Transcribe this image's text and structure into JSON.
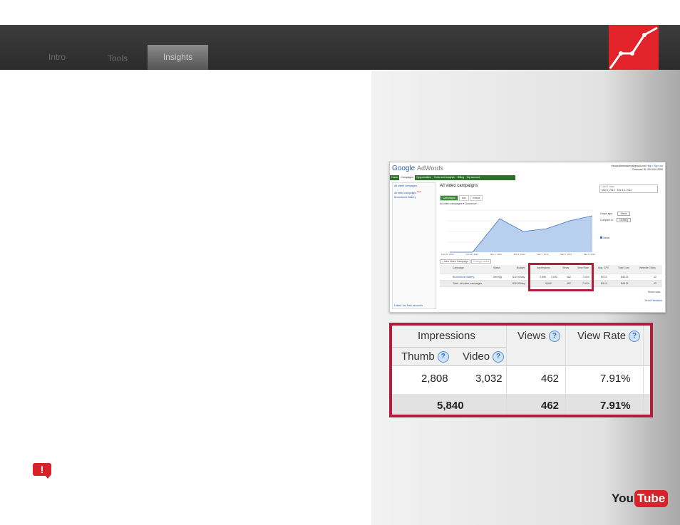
{
  "nav": {
    "tabs": [
      {
        "label": "Intro"
      },
      {
        "label": "Tools"
      },
      {
        "label": "Insights",
        "active": true
      }
    ]
  },
  "colors": {
    "brand_red": "#e2232a",
    "highlight": "#b01e3c",
    "adwords_green": "#2f6f2a"
  },
  "adwords": {
    "logo_google": "Google",
    "logo_adwords": "AdWords",
    "account_email": "thecaroltreebakery@gmail.com",
    "account_links": "Help | Sign out",
    "customer_id": "Customer ID: 000-000-0000",
    "nav": [
      "Home",
      "Campaigns",
      "Opportunities",
      "Tools and Analysis",
      "Billing",
      "My account"
    ],
    "sidebar": {
      "all_campaigns": "All online campaigns",
      "video_campaigns": "All video campaigns",
      "new_badge": "New",
      "campaign": "Brownstone Bakery",
      "linked": "Linked YouTube accounts"
    },
    "title": "All video campaigns",
    "date_label": "Last 7 days",
    "date_range": "Mar 8, 2012 - Mar 14, 2012",
    "tabs": [
      "Campaigns",
      "Ads",
      "Videos"
    ],
    "filters": "All-video campaigns ▾   Columns ▾",
    "graph_type_label": "Graph type",
    "graph_type_value": "Views",
    "compare_label": "Compare to",
    "compare_value": "Nothing",
    "legend": "Views",
    "chart_x": [
      "Feb 29, 2012",
      "Feb 28, 2012",
      "Mar 1, 2012",
      "Mar 4, 2012",
      "Mar 7, 2012",
      "Mar 8, 2012",
      "Mar 9, 2012"
    ],
    "buttons": {
      "new": "+ New Video Campaign",
      "change": "Change status"
    },
    "table_headers": [
      "Campaign",
      "Status",
      "Budget",
      "Impressions",
      "Views",
      "View Rate",
      "Avg. CPV",
      "Total Cost",
      "Website Clicks"
    ],
    "row": {
      "name": "Brownstone Bakery",
      "status": "Serving",
      "budget": "$10.00/day",
      "thumb": "2,808",
      "video": "3,032",
      "views": "462",
      "rate": "7.91%",
      "cpv": "$0.10",
      "cost": "$46.21",
      "clicks": "42"
    },
    "total": {
      "label": "Total - all video campaigns",
      "budget": "$10.00/day",
      "imp": "5,840",
      "views": "462",
      "rate": "7.91%",
      "cpv": "$0.10",
      "cost": "$46.21",
      "clicks": "42"
    },
    "show_rows": "Show rows:",
    "feedback": "Send Feedback"
  },
  "zoom": {
    "impressions": "Impressions",
    "views": "Views",
    "view_rate": "View Rate",
    "thumb": "Thumb",
    "video": "Video",
    "help_glyph": "?",
    "row1": {
      "thumb": "2,808",
      "video": "3,032",
      "views": "462",
      "rate": "7.91%"
    },
    "total": {
      "impressions": "5,840",
      "views": "462",
      "rate": "7.91%"
    }
  },
  "alert_icon": "exclamation-icon",
  "alert_glyph": "!",
  "youtube": {
    "you": "You",
    "tube": "Tube"
  }
}
